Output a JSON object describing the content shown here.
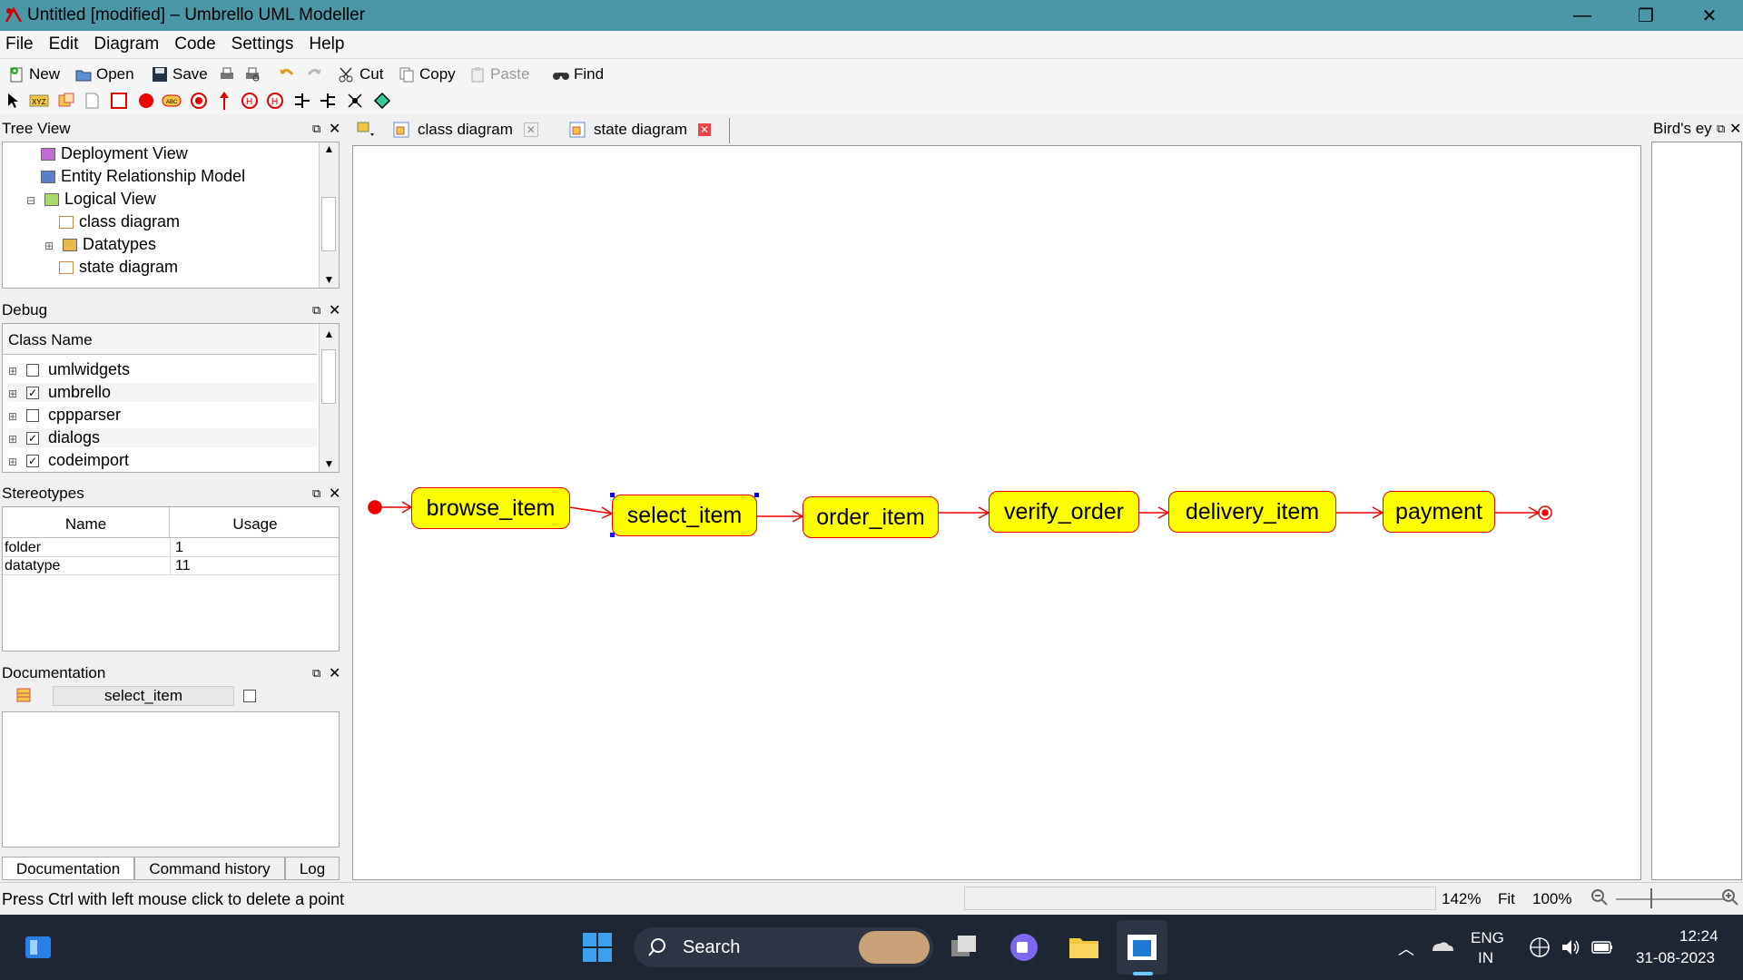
{
  "window": {
    "title": "Untitled [modified] – Umbrello UML Modeller"
  },
  "menu": [
    "File",
    "Edit",
    "Diagram",
    "Code",
    "Settings",
    "Help"
  ],
  "toolbar": {
    "new": "New",
    "open": "Open",
    "save": "Save",
    "cut": "Cut",
    "copy": "Copy",
    "paste": "Paste",
    "find": "Find"
  },
  "tree_view": {
    "title": "Tree View",
    "items": [
      "Deployment View",
      "Entity Relationship Model",
      "Logical View",
      "class diagram",
      "Datatypes",
      "state diagram"
    ]
  },
  "debug": {
    "title": "Debug",
    "column": "Class Name",
    "rows": [
      {
        "name": "umlwidgets",
        "checked": false
      },
      {
        "name": "umbrello",
        "checked": true
      },
      {
        "name": "cppparser",
        "checked": false
      },
      {
        "name": "dialogs",
        "checked": true
      },
      {
        "name": "codeimport",
        "checked": true
      }
    ]
  },
  "stereotypes": {
    "title": "Stereotypes",
    "col_name": "Name",
    "col_usage": "Usage",
    "rows": [
      {
        "name": "folder",
        "usage": "1"
      },
      {
        "name": "datatype",
        "usage": "11"
      }
    ]
  },
  "documentation": {
    "title": "Documentation",
    "item": "select_item",
    "tabs": [
      "Documentation",
      "Command history",
      "Log"
    ]
  },
  "tabs": [
    "class diagram",
    "state diagram"
  ],
  "birds_eye": {
    "title": "Bird's ey"
  },
  "diagram": {
    "states": [
      "browse_item",
      "select_item",
      "order_item",
      "verify_order",
      "delivery_item",
      "payment"
    ]
  },
  "status": {
    "message": "Press Ctrl with left mouse click to delete a point",
    "zoom": "142%",
    "fit": "Fit",
    "hundred": "100%"
  },
  "taskbar": {
    "search": "Search",
    "lang1": "ENG",
    "lang2": "IN",
    "time": "12:24",
    "date": "31-08-2023"
  }
}
